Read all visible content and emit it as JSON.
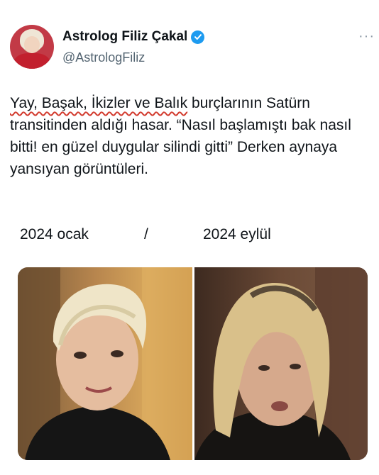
{
  "author": {
    "display_name": "Astrolog Filiz Çakal",
    "handle": "@AstrologFiliz"
  },
  "tweet": {
    "underlined": "Yay, Başak, İkizler ve Balık",
    "rest": " burçlarının Satürn transitinden aldığı hasar. “Nasıl başlamıştı bak nasıl bitti! en güzel duygular silindi gitti” Derken aynaya yansıyan görüntüleri."
  },
  "captions": {
    "left": "2024 ocak",
    "separator": "/",
    "right": "2024 eylül"
  },
  "colors": {
    "verified": "#1d9bf0",
    "spellcheck": "#d23b2e"
  },
  "icons": [
    "verified-badge-icon",
    "more-icon"
  ]
}
